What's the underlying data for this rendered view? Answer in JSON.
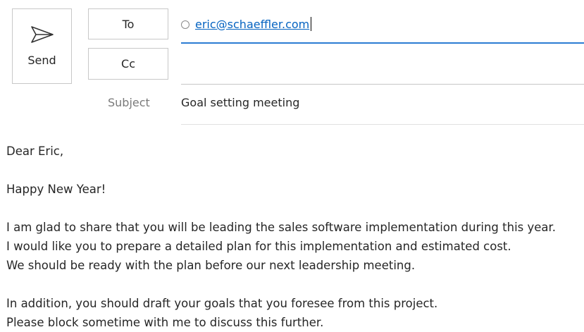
{
  "header": {
    "send_label": "Send",
    "to_label": "To",
    "cc_label": "Cc",
    "subject_label": "Subject"
  },
  "recipients": {
    "to": [
      {
        "email": "eric@schaeffler.com"
      }
    ],
    "cc": []
  },
  "subject": "Goal setting meeting",
  "body": {
    "greeting": "Dear Eric,",
    "line2": "Happy New Year!",
    "para1": [
      "I am glad to share that you will be leading the sales software implementation during this year.",
      "I would like you to prepare a detailed plan for this implementation and estimated cost.",
      "We should be ready with the plan before our next leadership meeting."
    ],
    "para2": [
      "In addition, you should draft your goals that you foresee from this project.",
      "Please block sometime with me to discuss this further."
    ]
  },
  "icons": {
    "send": "send-icon",
    "recipient_status": "radio-circle-icon"
  },
  "colors": {
    "accent": "#2b7cd3",
    "link": "#0563c1",
    "label": "#7a7a7a"
  }
}
